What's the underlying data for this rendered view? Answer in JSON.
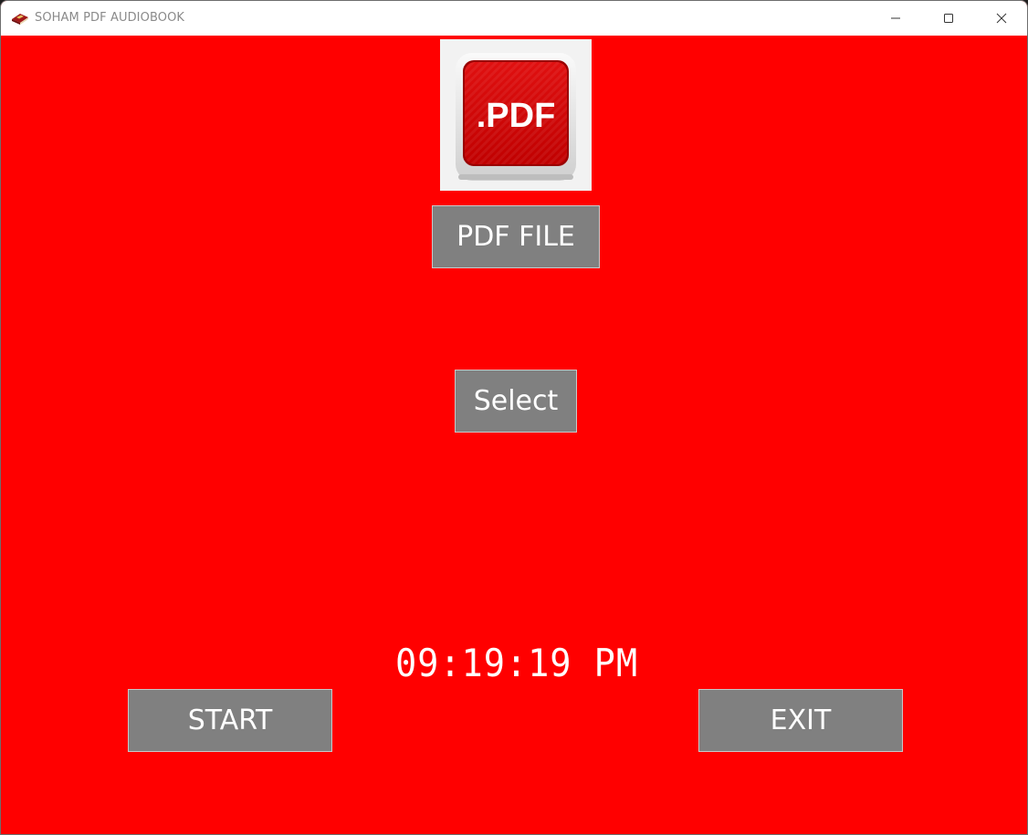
{
  "window": {
    "title": "SOHAM PDF AUDIOBOOK",
    "app_icon": "book-icon",
    "controls": {
      "minimize_icon": "minimize-icon",
      "maximize_icon": "maximize-icon",
      "close_icon": "close-icon"
    }
  },
  "colors": {
    "background": "#ff0000",
    "button_bg": "#808080",
    "button_text": "#ffffff",
    "clock_text": "#ffffff"
  },
  "logo": {
    "icon": "pdf-file-icon",
    "text": ".PDF"
  },
  "buttons": {
    "pdf_file": "PDF FILE",
    "select": "Select",
    "start": "START",
    "exit": "EXIT"
  },
  "clock": {
    "time": "09:19:19 PM"
  }
}
